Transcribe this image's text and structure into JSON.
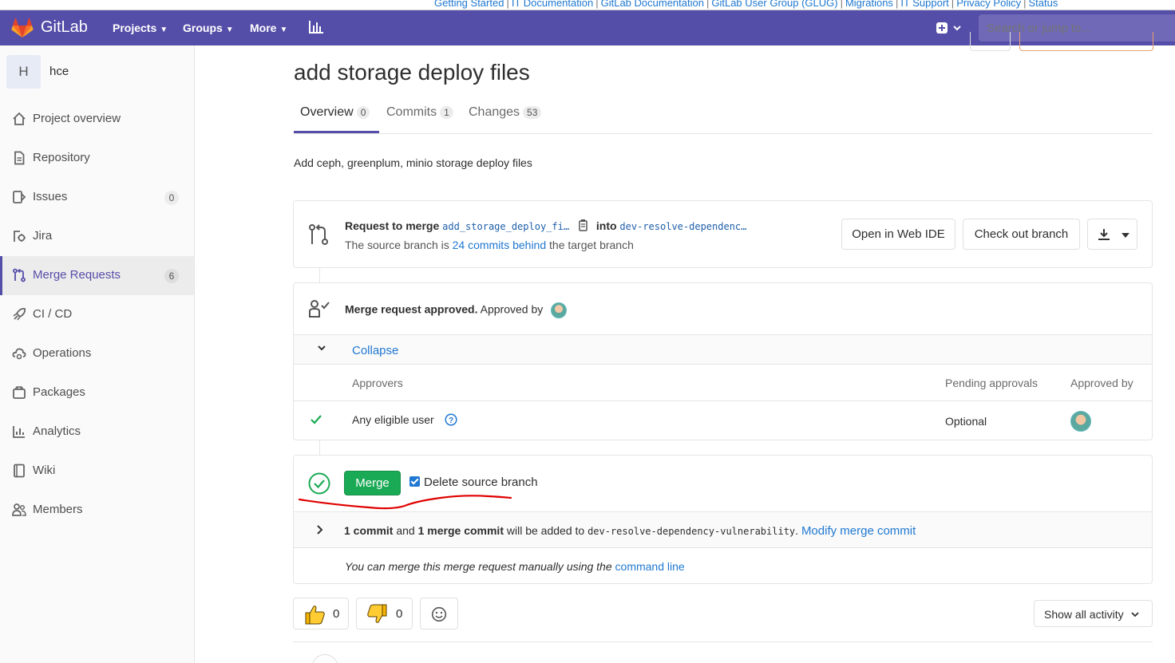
{
  "infobar": {
    "links": [
      "Getting Started",
      "IT Documentation",
      "GitLab Documentation",
      "GitLab User Group (GLUG)",
      "Migrations",
      "IT Support",
      "Privacy Policy",
      "Status"
    ],
    "separator": "|"
  },
  "navbar": {
    "brand": "GitLab",
    "projects": "Projects",
    "groups": "Groups",
    "more": "More",
    "search_placeholder": "Search or jump to..."
  },
  "sidebar": {
    "project_initial": "H",
    "project_name": "hce",
    "items": [
      {
        "label": "Project overview",
        "icon": "home-icon"
      },
      {
        "label": "Repository",
        "icon": "document-icon"
      },
      {
        "label": "Issues",
        "icon": "issues-icon",
        "count": "0"
      },
      {
        "label": "Jira",
        "icon": "jira-icon"
      },
      {
        "label": "Merge Requests",
        "icon": "merge-request-icon",
        "count": "6",
        "active": true
      },
      {
        "label": "CI / CD",
        "icon": "rocket-icon"
      },
      {
        "label": "Operations",
        "icon": "cloud-gear-icon"
      },
      {
        "label": "Packages",
        "icon": "package-icon"
      },
      {
        "label": "Analytics",
        "icon": "chart-icon"
      },
      {
        "label": "Wiki",
        "icon": "book-icon"
      },
      {
        "label": "Members",
        "icon": "users-icon"
      }
    ]
  },
  "mr": {
    "title": "add storage deploy files",
    "tabs": [
      {
        "label": "Overview",
        "count": "0"
      },
      {
        "label": "Commits",
        "count": "1"
      },
      {
        "label": "Changes",
        "count": "53"
      }
    ],
    "description": "Add ceph, greenplum, minio storage deploy files",
    "request_prefix": "Request to merge",
    "source_branch": "add_storage_deploy_fi…",
    "into": "into",
    "target_branch": "dev-resolve-dependenc…",
    "behind_prefix": "The source branch is",
    "behind_link": "24 commits behind",
    "behind_suffix": "the target branch",
    "open_web_ide": "Open in Web IDE",
    "checkout_branch": "Check out branch"
  },
  "approvals": {
    "status": "Merge request approved.",
    "approved_by": "Approved by",
    "collapse": "Collapse",
    "headers": {
      "approvers": "Approvers",
      "pending": "Pending approvals",
      "approved_by": "Approved by"
    },
    "row": {
      "approver": "Any eligible user",
      "pending": "Optional"
    }
  },
  "merge": {
    "button": "Merge",
    "delete_source": "Delete source branch",
    "commit_count": "1 commit",
    "and": "and",
    "merge_commit": "1 merge commit",
    "will_be_added": "will be added to",
    "target_branch_full": "dev-resolve-dependency-vulnerability",
    "period": ".",
    "modify": "Modify merge commit",
    "manual_prefix": "You can merge this merge request manually using the",
    "command_line": "command line"
  },
  "reactions": {
    "thumbs_up": "0",
    "thumbs_down": "0",
    "activity": "Show all activity"
  },
  "colors": {
    "navbar": "#554ea8",
    "merge_green": "#1aaa55",
    "link_blue": "#1f78d1"
  }
}
